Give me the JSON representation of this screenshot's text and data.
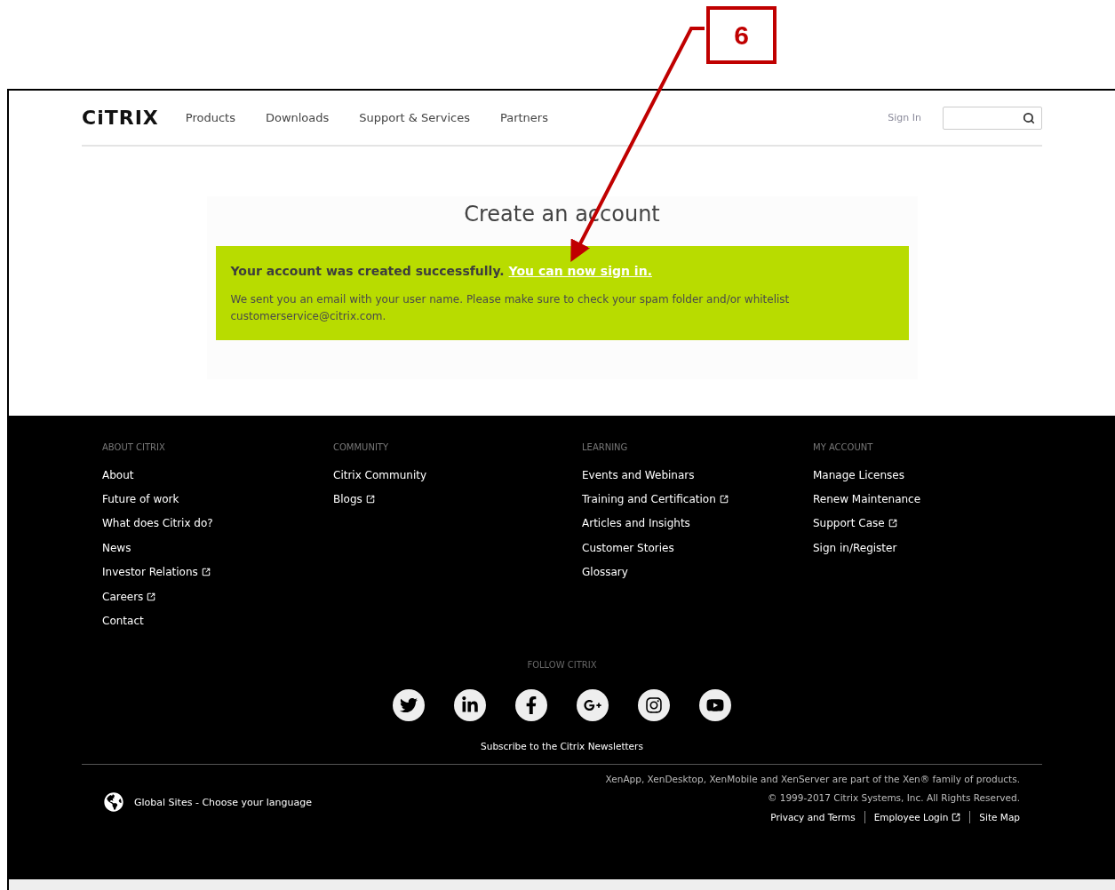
{
  "annotation": {
    "label": "6"
  },
  "header": {
    "logo": "CiTRIX",
    "nav": [
      "Products",
      "Downloads",
      "Support & Services",
      "Partners"
    ],
    "sign_in": "Sign In"
  },
  "main": {
    "title": "Create an account",
    "message": {
      "headline": "Your account was created successfully.",
      "link": "You can now sign in.",
      "body": "We sent you an email with your user name. Please make sure to check your spam folder and/or whitelist customerservice@citrix.com."
    }
  },
  "footer": {
    "columns": [
      {
        "heading": "ABOUT CITRIX",
        "links": [
          {
            "label": "About",
            "external": false
          },
          {
            "label": "Future of work",
            "external": false
          },
          {
            "label": "What does Citrix do?",
            "external": false
          },
          {
            "label": "News",
            "external": false
          },
          {
            "label": "Investor Relations",
            "external": true
          },
          {
            "label": "Careers",
            "external": true
          },
          {
            "label": "Contact",
            "external": false
          }
        ]
      },
      {
        "heading": "COMMUNITY",
        "links": [
          {
            "label": "Citrix Community",
            "external": false
          },
          {
            "label": "Blogs",
            "external": true
          }
        ]
      },
      {
        "heading": "LEARNING",
        "links": [
          {
            "label": "Events and Webinars",
            "external": false
          },
          {
            "label": "Training and Certification",
            "external": true
          },
          {
            "label": "Articles and Insights",
            "external": false
          },
          {
            "label": "Customer Stories",
            "external": false
          },
          {
            "label": "Glossary",
            "external": false
          }
        ]
      },
      {
        "heading": "MY ACCOUNT",
        "links": [
          {
            "label": "Manage Licenses",
            "external": false
          },
          {
            "label": "Renew Maintenance",
            "external": false
          },
          {
            "label": "Support Case",
            "external": true
          },
          {
            "label": "Sign in/Register",
            "external": false
          }
        ]
      }
    ],
    "follow": {
      "heading": "FOLLOW CITRIX",
      "icons": [
        {
          "kind": "twitter"
        },
        {
          "kind": "linkedin"
        },
        {
          "kind": "facebook"
        },
        {
          "kind": "googleplus"
        },
        {
          "kind": "instagram"
        },
        {
          "kind": "youtube"
        }
      ]
    },
    "subscribe": "Subscribe to the Citrix Newsletters",
    "global_sites": "Global Sites - Choose your language",
    "legal": {
      "products_note": "XenApp, XenDesktop, XenMobile and XenServer are part of the Xen® family of products.",
      "copyright": "© 1999-2017 Citrix Systems, Inc. All Rights Reserved.",
      "links": [
        {
          "label": "Privacy and Terms",
          "external": false
        },
        {
          "label": "Employee Login",
          "external": true
        },
        {
          "label": "Site Map",
          "external": false
        }
      ]
    }
  }
}
